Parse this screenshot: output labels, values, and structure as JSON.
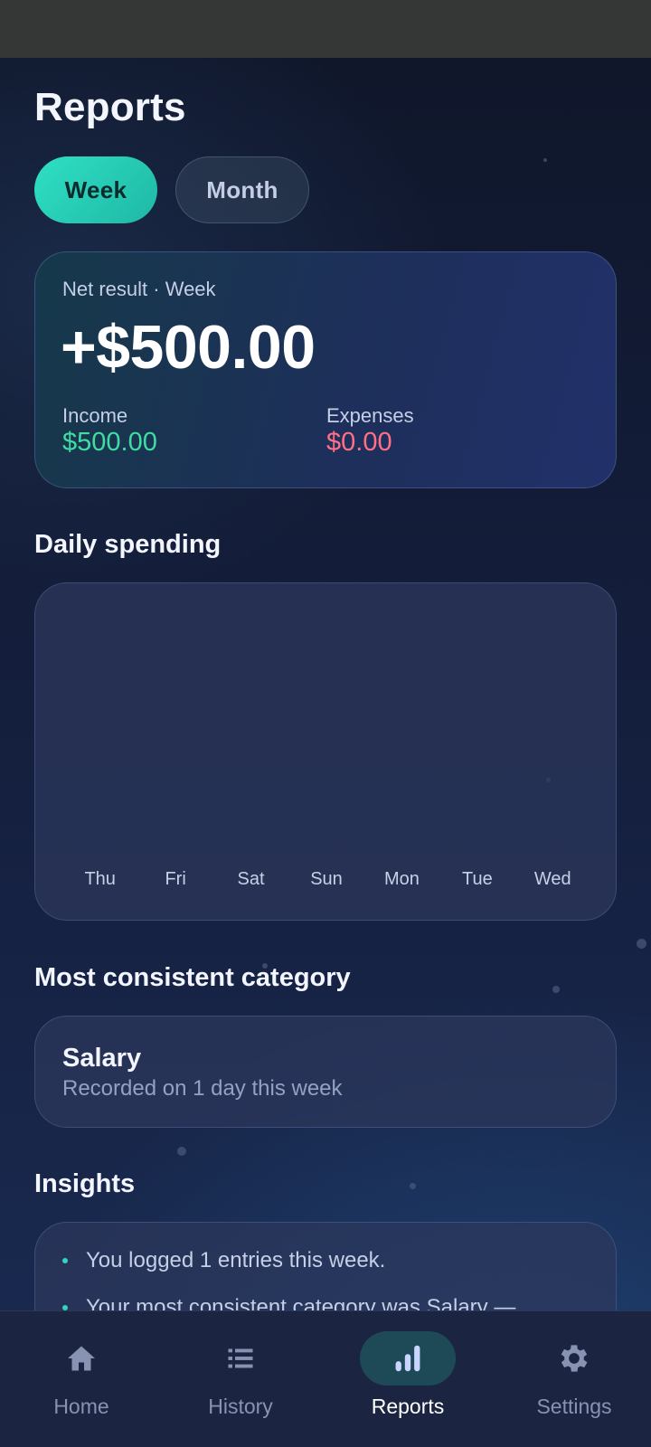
{
  "page": {
    "title": "Reports"
  },
  "period_toggle": {
    "week_label": "Week",
    "month_label": "Month"
  },
  "net_card": {
    "label": "Net result · Week",
    "value": "+$500.00",
    "income_label": "Income",
    "income_value": "$500.00",
    "expenses_label": "Expenses",
    "expenses_value": "$0.00",
    "income_color": "#3fdca4",
    "expenses_color": "#ff6f86"
  },
  "daily_spending": {
    "title": "Daily spending",
    "days": [
      "Thu",
      "Fri",
      "Sat",
      "Sun",
      "Mon",
      "Tue",
      "Wed"
    ]
  },
  "consistent_category": {
    "title": "Most consistent category",
    "name": "Salary",
    "description": "Recorded on 1 day this week"
  },
  "insights": {
    "title": "Insights",
    "items": [
      "You logged 1 entries this week.",
      "Your most consistent category was Salary —"
    ]
  },
  "bottom_nav": {
    "items": [
      {
        "label": "Home",
        "icon": "home-icon"
      },
      {
        "label": "History",
        "icon": "list-icon"
      },
      {
        "label": "Reports",
        "icon": "bar-chart-icon"
      },
      {
        "label": "Settings",
        "icon": "gear-icon"
      }
    ],
    "active": "Reports"
  },
  "colors": {
    "accent": "#2fe0c4",
    "background": "#152040",
    "nav_background": "#1b2440"
  }
}
